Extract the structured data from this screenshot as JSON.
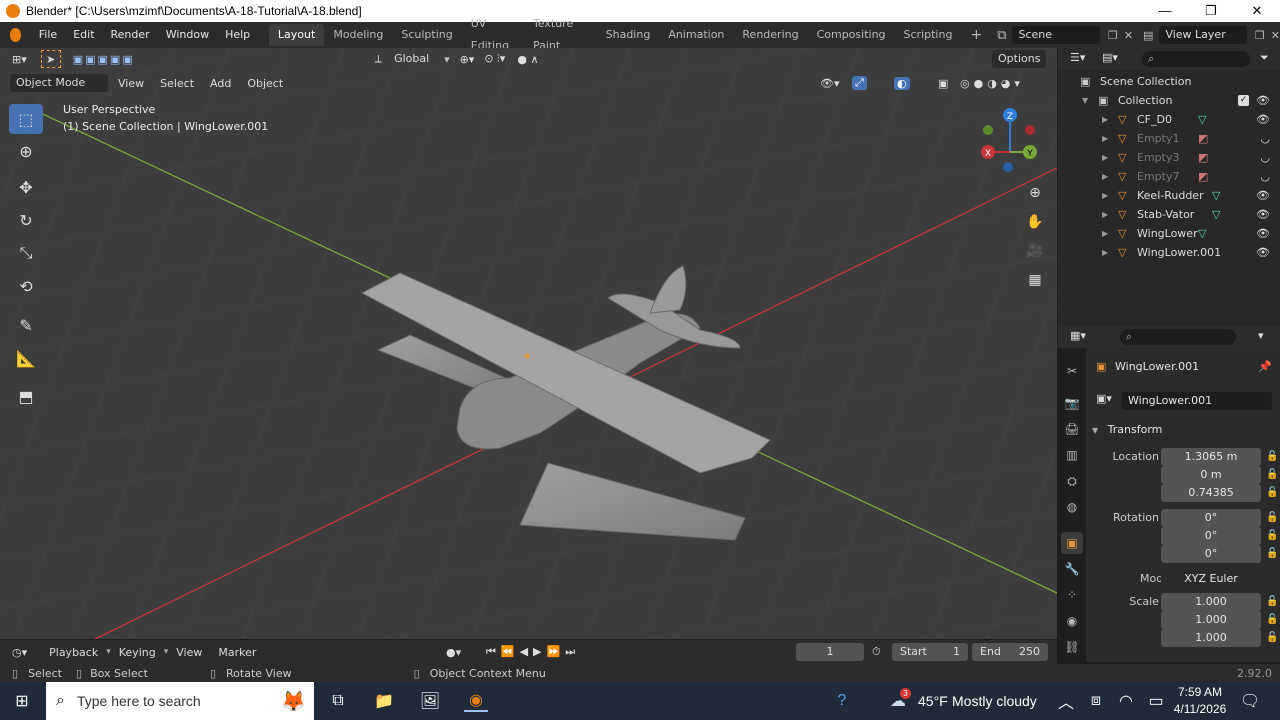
{
  "window": {
    "title": "Blender* [C:\\Users\\mzimf\\Documents\\A-18-Tutorial\\A-18.blend]",
    "minimize": "—",
    "restore": "❐",
    "close": "✕"
  },
  "menu": [
    "File",
    "Edit",
    "Render",
    "Window",
    "Help"
  ],
  "workspaces": [
    "Layout",
    "Modeling",
    "Sculpting",
    "UV Editing",
    "Texture Paint",
    "Shading",
    "Animation",
    "Rendering",
    "Compositing",
    "Scripting"
  ],
  "active_workspace": "Layout",
  "add_tab": "+",
  "scene_name": "Scene",
  "view_layer": "View Layer",
  "viewport": {
    "mode": "Object Mode",
    "header_menus": [
      "View",
      "Select",
      "Add",
      "Object"
    ],
    "transform_orientation": "Global",
    "options_label": "Options",
    "perspective_label": "User Perspective",
    "context_label": "(1) Scene Collection | WingLower.001",
    "gizmo_axes": [
      "X",
      "Y",
      "Z"
    ]
  },
  "outliner": {
    "root": "Scene Collection",
    "collection": "Collection",
    "items": [
      {
        "name": "CF_D0",
        "dim": false,
        "type": "mesh"
      },
      {
        "name": "Empty1",
        "dim": true,
        "type": "empty"
      },
      {
        "name": "Empty3",
        "dim": true,
        "type": "empty"
      },
      {
        "name": "Empty7",
        "dim": true,
        "type": "empty"
      },
      {
        "name": "Keel-Rudder",
        "dim": false,
        "type": "mesh"
      },
      {
        "name": "Stab-Vator",
        "dim": false,
        "type": "mesh"
      },
      {
        "name": "WingLower",
        "dim": false,
        "type": "mesh"
      },
      {
        "name": "WingLower.001",
        "dim": false,
        "type": "mesh"
      }
    ]
  },
  "properties": {
    "object_name": "WingLower.001",
    "datablock_name": "WingLower.001",
    "panel_title": "Transform",
    "location": {
      "label": "Location X",
      "x": "1.3065 m",
      "y": "0 m",
      "z": "0.74385"
    },
    "rotation": {
      "label": "Rotation X",
      "x": "0°",
      "y": "0°",
      "z": "0°"
    },
    "mode_label": "Mode",
    "mode_value": "XYZ Euler",
    "scale": {
      "label": "Scale X",
      "x": "1.000",
      "y": "1.000",
      "z": "1.000"
    },
    "axis_y": "Y",
    "axis_z": "Z"
  },
  "timeline": {
    "menus": [
      "Playback",
      "Keying",
      "View",
      "Marker"
    ],
    "current_frame": "1",
    "start_label": "Start",
    "start": "1",
    "end_label": "End",
    "end": "250"
  },
  "status": {
    "select": "Select",
    "box_select": "Box Select",
    "rotate_view": "Rotate View",
    "context_menu": "Object Context Menu",
    "version": "2.92.0"
  },
  "taskbar": {
    "search_placeholder": "Type here to search",
    "temperature": "45°F",
    "weather": "Mostly cloudy",
    "weather_badge": "3",
    "time": "7:59 AM",
    "date": "4/11/2026"
  },
  "colors": {
    "accent_blue": "#4772b3",
    "object_orange": "#e8963a",
    "x_axis": "#c9353b",
    "y_axis": "#7aa83a",
    "z_axis": "#2e7fe0"
  }
}
